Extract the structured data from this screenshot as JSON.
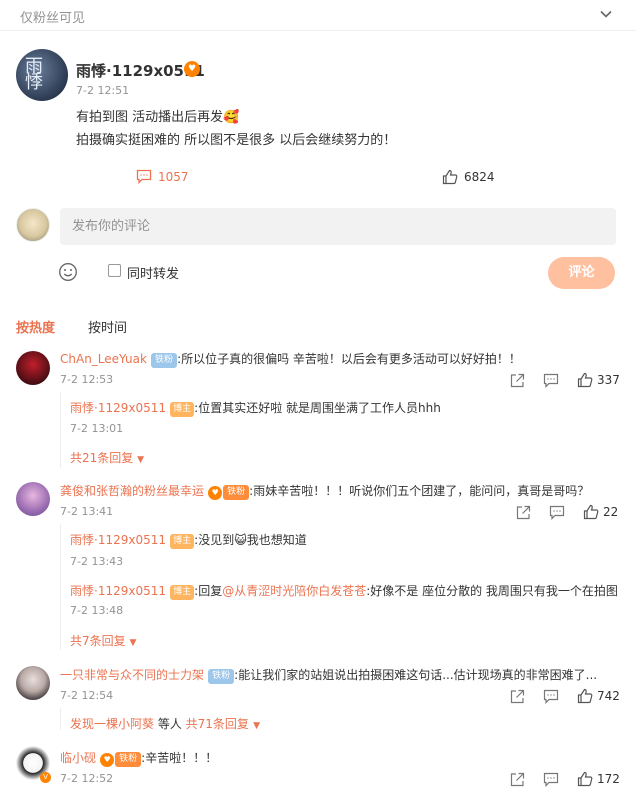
{
  "header": {
    "visibility_label": "仅粉丝可见"
  },
  "post": {
    "author": "雨悸·1129x0511",
    "time": "7-2 12:51",
    "line1": "有拍到图 活动播出后再发🥰",
    "line2": "拍摄确实挺困难的 所以图不是很多 以后会继续努力的！",
    "comment_count": "1057",
    "like_count": "6824"
  },
  "compose": {
    "placeholder": "发布你的评论",
    "repost_label": "同时转发",
    "submit_label": "评论"
  },
  "sort": {
    "hot": "按热度",
    "time": "按时间"
  },
  "comments": [
    {
      "name": "ChAn_LeeYuak",
      "badge": "铁粉",
      "text": ":所以位子真的很偏吗 辛苦啦！以后会有更多活动可以好好拍！！",
      "time": "7-2 12:53",
      "likes": "337",
      "replies": [
        {
          "name": "雨悸·1129x0511",
          "badge": "博主",
          "text": ":位置其实还好啦 就是周围坐满了工作人员hhh",
          "time": "7-2 13:01"
        }
      ],
      "more": "共21条回复"
    },
    {
      "name": "龚俊和张哲瀚的粉丝最幸运",
      "badge": "铁粉",
      "text": ":雨妹辛苦啦！！！听说你们五个团建了，能问问，真哥是哥吗？",
      "time": "7-2 13:41",
      "likes": "22",
      "replies": [
        {
          "name": "雨悸·1129x0511",
          "badge": "博主",
          "text": ":没见到😺我也想知道",
          "time": "7-2 13:43"
        },
        {
          "name": "雨悸·1129x0511",
          "badge": "博主",
          "prefix": ":回复",
          "mention": "@从青涩时光陪你白发苍苍",
          "text": ":好像不是 座位分散的 我周围只有我一个在拍图",
          "time": "7-2 13:48"
        }
      ],
      "more": "共7条回复"
    },
    {
      "name": "一只非常与众不同的士力架",
      "badge": "铁粉",
      "text": ":能让我们家的站姐说出拍摄困难这句话...估计现场真的非常困难了...",
      "time": "7-2 12:54",
      "likes": "742",
      "reply_summary": {
        "who": "发现一棵小阿葵",
        "rest": " 等人 ",
        "count": "共71条回复"
      }
    },
    {
      "name": "临小砚",
      "badge": "铁粉",
      "text": ":辛苦啦！！！",
      "time": "7-2 12:52",
      "likes": "172"
    }
  ],
  "colors": {
    "accent": "#eb7350",
    "muted": "#939393",
    "submit": "#ffc09f"
  }
}
